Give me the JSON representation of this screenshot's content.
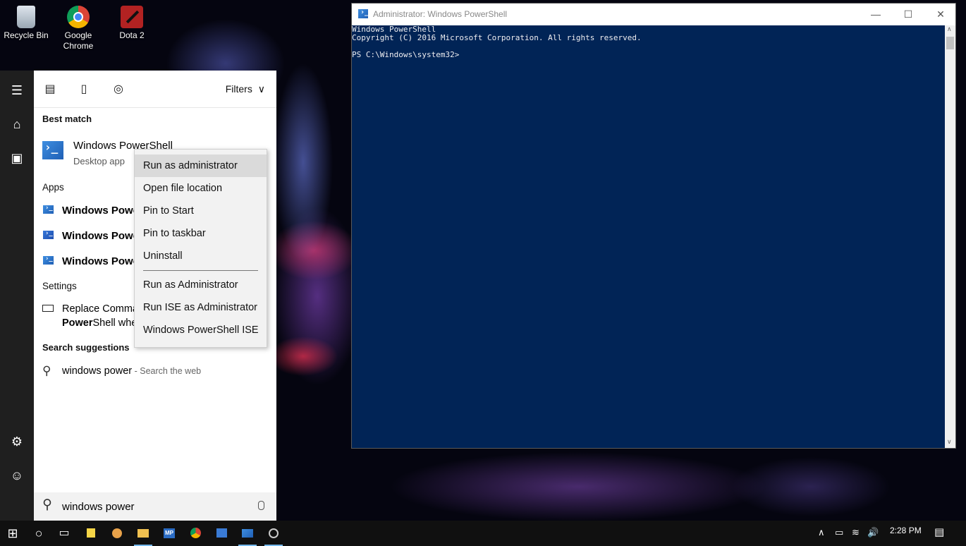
{
  "desktop": {
    "icons": [
      {
        "label": "Recycle Bin",
        "icon": "recycle-bin-icon"
      },
      {
        "label": "Google Chrome",
        "icon": "chrome-icon"
      },
      {
        "label": "Dota 2",
        "icon": "dota2-icon"
      }
    ]
  },
  "start": {
    "rail": {
      "menu_icon": "☰",
      "home_icon": "⌂",
      "notebook_icon": "▣",
      "settings_icon": "⚙",
      "feedback_icon": "☺"
    },
    "filters": {
      "label": "Filters",
      "chevron": "∨"
    },
    "best_match": {
      "title": "Best match",
      "name_prefix": "Windows Power",
      "name_suffix": "Shell",
      "subtitle": "Desktop app"
    },
    "apps": {
      "title": "Apps",
      "items": [
        "Windows Powe",
        "Windows Powe",
        "Windows Powe"
      ]
    },
    "settings": {
      "title": "Settings",
      "line1": "Replace Comma",
      "line2_bold": "Power",
      "line2_rest": "Shell whe"
    },
    "suggestions": {
      "title": "Search suggestions",
      "query": "windows power",
      "hint": " - Search the web"
    },
    "search": {
      "value": "windows power",
      "search_icon": "⚲",
      "mic_icon": "🎙"
    }
  },
  "context_menu": {
    "group1": [
      "Run as administrator",
      "Open file location",
      "Pin to Start",
      "Pin to taskbar",
      "Uninstall"
    ],
    "group2": [
      "Run as Administrator",
      "Run ISE as Administrator",
      "Windows PowerShell ISE"
    ]
  },
  "powershell": {
    "title": "Administrator: Windows PowerShell",
    "minimize": "—",
    "maximize": "☐",
    "close": "✕",
    "console_lines": [
      "Windows PowerShell",
      "Copyright (C) 2016 Microsoft Corporation. All rights reserved.",
      "",
      "PS C:\\Windows\\system32>"
    ],
    "scroll_up": "∧",
    "scroll_down": "∨"
  },
  "taskbar": {
    "start_icon": "⊞",
    "cortana_icon": "○",
    "taskview_icon": "▭",
    "tray_chevron": "∧",
    "battery_icon": "▭",
    "network_icon": "≋",
    "volume_icon": "🔊",
    "time": "2:28 PM",
    "notification_icon": "▤"
  },
  "colors": {
    "console_bg": "#012456",
    "accent": "#76b9ed"
  }
}
